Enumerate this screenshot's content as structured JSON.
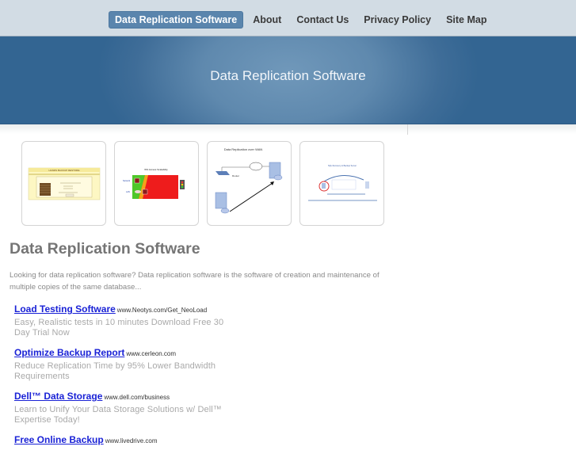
{
  "nav": {
    "items": [
      {
        "label": "Data Replication Software",
        "active": true
      },
      {
        "label": "About",
        "active": false
      },
      {
        "label": "Contact Us",
        "active": false
      },
      {
        "label": "Privacy Policy",
        "active": false
      },
      {
        "label": "Site Map",
        "active": false
      }
    ]
  },
  "banner": {
    "title": "Data Replication Software"
  },
  "thumbnails": [
    {
      "caption": "HANDS BACKUP RESTORE"
    },
    {
      "caption": "WS Access Scalability"
    },
    {
      "caption": "Data Replication over WAN"
    },
    {
      "caption": "SQL Recovery to Backup Server"
    }
  ],
  "content": {
    "title": "Data Replication Software",
    "intro": "Looking for data replication software? Data replication software is the software of creation and maintenance of multiple copies of the same database..."
  },
  "ads": [
    {
      "title": "Load Testing Software",
      "url": "www.Neotys.com/Get_NeoLoad",
      "desc": "Easy, Realistic tests in 10 minutes Download Free 30 Day Trial Now"
    },
    {
      "title": "Optimize Backup Report",
      "url": "www.cerleon.com",
      "desc": "Reduce Replication Time by 95% Lower Bandwidth Requirements"
    },
    {
      "title": "Dell™ Data Storage",
      "url": "www.dell.com/business",
      "desc": "Learn to Unify Your Data Storage Solutions w/ Dell™ Expertise Today!"
    },
    {
      "title": "Free Online Backup",
      "url": "www.livedrive.com",
      "desc": ""
    }
  ]
}
